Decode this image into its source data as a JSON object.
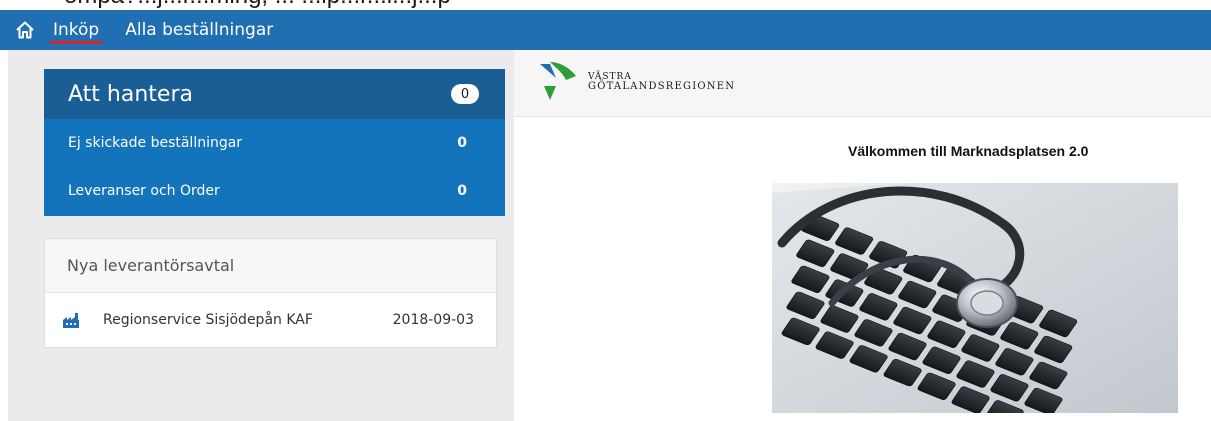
{
  "cutoff_text": "ompa?...j...r...ming, ... ...ip...r...l...j...p",
  "nav": {
    "home_icon": "home-icon",
    "items": [
      {
        "label": "Inköp",
        "active": true
      },
      {
        "label": "Alla beställningar",
        "active": false
      }
    ]
  },
  "tasks": {
    "title": "Att hantera",
    "count": "0",
    "rows": [
      {
        "label": "Ej skickade beställningar",
        "value": "0"
      },
      {
        "label": "Leveranser och Order",
        "value": "0"
      }
    ]
  },
  "contracts": {
    "title": "Nya leverantörsavtal",
    "rows": [
      {
        "icon": "factory-icon",
        "name": "Regionservice Sisjödepån KAF",
        "date": "2018-09-03"
      }
    ]
  },
  "brand": {
    "line1": "VÄSTRA",
    "line2": "GÖTALANDSREGIONEN"
  },
  "welcome": "Välkommen till Marknadsplatsen 2.0",
  "colors": {
    "topbar": "#1f6fb2",
    "tasks_header": "#1a5e96",
    "tasks_body": "#1374bb",
    "active_underline": "#e02020",
    "logo_green": "#2e9e3a",
    "logo_blue": "#1f6fb2"
  }
}
